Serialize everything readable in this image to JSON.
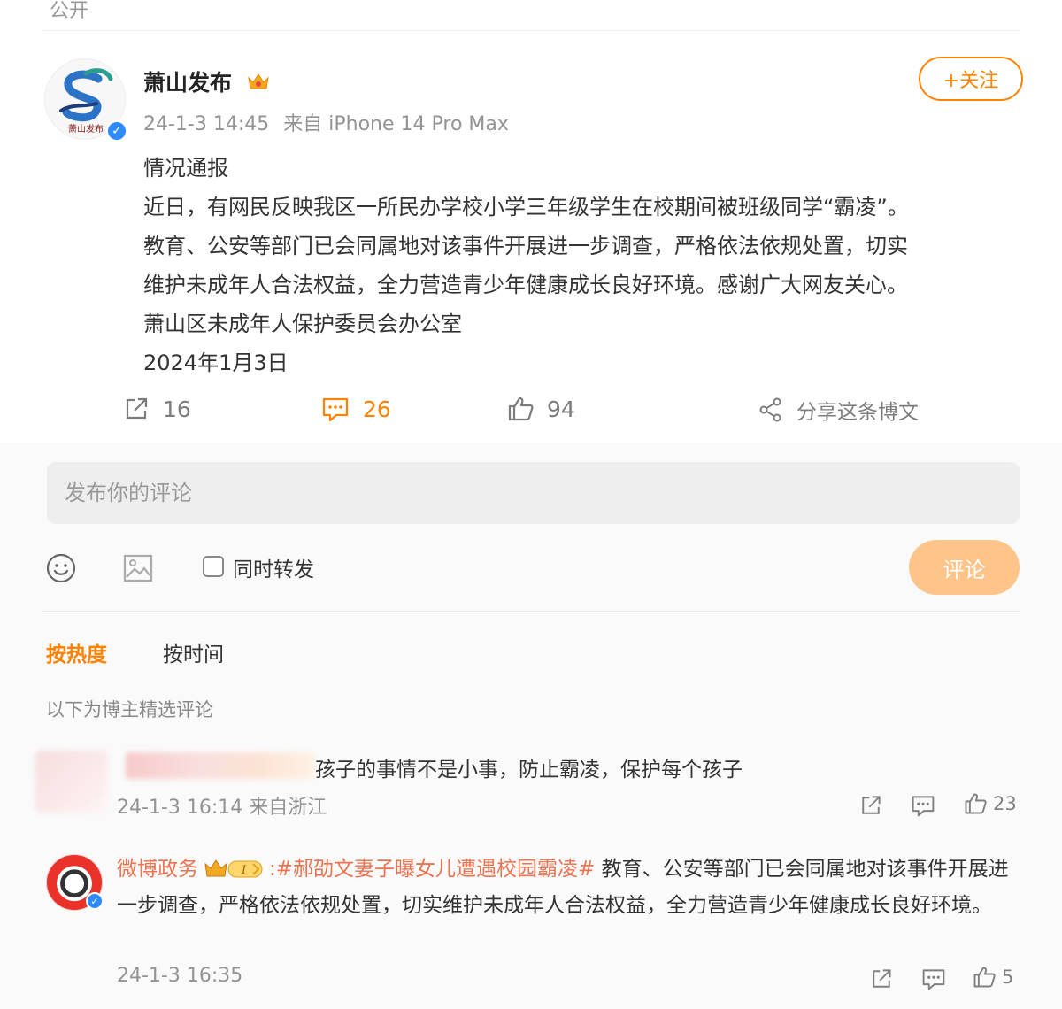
{
  "page": {
    "visibility_label": "公开"
  },
  "post": {
    "author": {
      "name": "萧山发布",
      "avatar_text": "萧山发布"
    },
    "follow_label": "+关注",
    "timestamp": "24-1-3 14:45",
    "source": "来自 iPhone 14 Pro Max",
    "body_lines": [
      "情况通报",
      "近日，有网民反映我区一所民办学校小学三年级学生在校期间被班级同学“霸凌”。",
      "教育、公安等部门已会同属地对该事件开展进一步调查，严格依法依规处置，切实",
      "维护未成年人合法权益，全力营造青少年健康成长良好环境。感谢广大网友关心。",
      "萧山区未成年人保护委员会办公室",
      "2024年1月3日"
    ],
    "actions": {
      "repost_count": "16",
      "comment_count": "26",
      "like_count": "94",
      "share_label": "分享这条博文"
    }
  },
  "composer": {
    "placeholder": "发布你的评论",
    "sync_repost_label": "同时转发",
    "submit_label": "评论"
  },
  "sort_tabs": {
    "hot": "按热度",
    "time": "按时间"
  },
  "selected_note": "以下为博主精选评论",
  "comments": [
    {
      "text": "孩子的事情不是小事，防止霸凌，保护每个孩子",
      "meta": "24-1-3 16:14 来自浙江",
      "like_count": "23"
    },
    {
      "name": "微博政务",
      "topic": ":#郝劭文妻子曝女儿遭遇校园霸凌#",
      "text": " 教育、公安等部门已会同属地对该事件开展进一步调查，严格依法依规处置，切实维护未成年人合法权益，全力营造青少年健康成长良好环境。",
      "meta": "24-1-3 16:35",
      "like_count": "5"
    }
  ],
  "colors": {
    "accent": "#ff8200",
    "topic": "#eb7350",
    "submit_disabled": "#ffc48a"
  }
}
